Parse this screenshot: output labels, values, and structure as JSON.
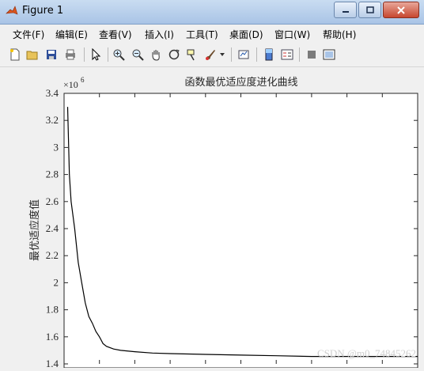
{
  "window": {
    "title": "Figure 1"
  },
  "menu": {
    "items": [
      "文件(F)",
      "编辑(E)",
      "查看(V)",
      "插入(I)",
      "工具(T)",
      "桌面(D)",
      "窗口(W)",
      "帮助(H)"
    ]
  },
  "toolbar": {
    "icons": [
      "new-file-icon",
      "open-folder-icon",
      "save-icon",
      "print-icon",
      "pointer-icon",
      "zoom-in-icon",
      "zoom-out-icon",
      "pan-icon",
      "rotate-3d-icon",
      "data-cursor-icon",
      "brush-icon",
      "brush-dropdown-icon",
      "link-plot-icon",
      "colorbar-icon",
      "legend-icon",
      "hide-plot-tools-icon",
      "show-plot-tools-icon"
    ]
  },
  "chart_data": {
    "type": "line",
    "title": "函数最优适应度进化曲线",
    "xlabel": "",
    "ylabel": "最优适应度值",
    "y_exponent_label": "×10",
    "y_exponent_power": "6",
    "ylim": [
      1.4,
      3.4
    ],
    "xlim": [
      0,
      100
    ],
    "yticks": [
      "1.4",
      "1.6",
      "1.8",
      "2",
      "2.2",
      "2.4",
      "2.6",
      "2.8",
      "3",
      "3.2",
      "3.4"
    ],
    "grid": false,
    "series": [
      {
        "x": [
          1,
          1.5,
          2,
          3,
          4,
          5,
          6,
          7,
          8,
          9,
          10,
          11,
          12,
          14,
          16,
          20,
          25,
          30,
          40,
          50,
          60,
          70,
          80,
          100
        ],
        "y": [
          3.3,
          2.8,
          2.6,
          2.4,
          2.15,
          2.0,
          1.85,
          1.75,
          1.7,
          1.64,
          1.6,
          1.55,
          1.53,
          1.51,
          1.5,
          1.49,
          1.48,
          1.476,
          1.47,
          1.465,
          1.46,
          1.455,
          1.455,
          1.455
        ]
      }
    ]
  },
  "watermark": "CSDN @m0_74845262"
}
